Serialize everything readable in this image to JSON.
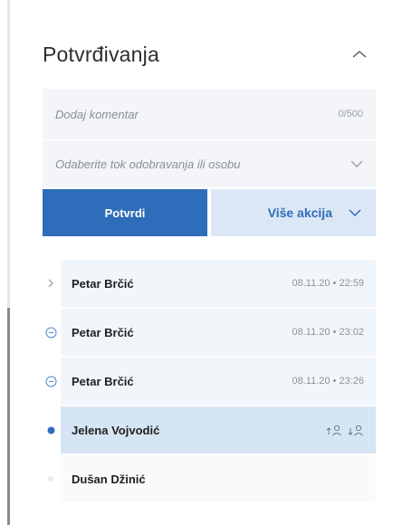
{
  "panel": {
    "title": "Potvrđivanja",
    "comment": {
      "placeholder": "Dodaj komentar",
      "counter": "0/500"
    },
    "approver_select": {
      "placeholder": "Odaberite tok odobravanja ili osobu"
    },
    "buttons": {
      "confirm": "Potvrdi",
      "more": "Više akcija"
    }
  },
  "steps": [
    {
      "name": "Petar Brčić",
      "time": "08.11.20 • 22:59",
      "marker": "chevron-right-icon"
    },
    {
      "name": "Petar Brčić",
      "time": "08.11.20 • 23:02",
      "marker": "circle-check-icon"
    },
    {
      "name": "Petar Brčić",
      "time": "08.11.20 • 23:26",
      "marker": "circle-check-icon"
    },
    {
      "name": "Jelena Vojvodić",
      "time": "",
      "marker": "current-dot-icon"
    },
    {
      "name": "Dušan Džinić",
      "time": "",
      "marker": "pending-dot-icon"
    }
  ],
  "colors": {
    "primary": "#2e6dba",
    "secondary_bg": "#dbe7f5",
    "row_bg": "#f1f6fb",
    "active_row_bg": "#d6e5f4"
  }
}
